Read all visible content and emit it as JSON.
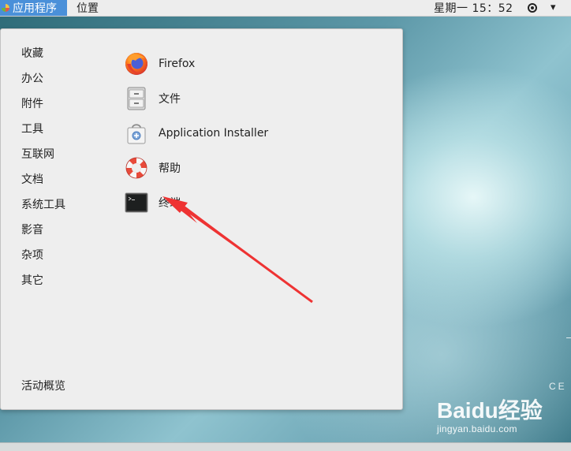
{
  "topbar": {
    "apps_label": "应用程序",
    "places_label": "位置",
    "clock": "星期一 15：52"
  },
  "menu": {
    "categories": [
      "收藏",
      "办公",
      "附件",
      "工具",
      "互联网",
      "文档",
      "系统工具",
      "影音",
      "杂项",
      "其它"
    ],
    "overview_label": "活动概览",
    "apps": [
      {
        "label": "Firefox",
        "icon": "firefox-icon"
      },
      {
        "label": "文件",
        "icon": "file-cabinet-icon"
      },
      {
        "label": "Application Installer",
        "icon": "software-bag-icon"
      },
      {
        "label": "帮助",
        "icon": "lifebuoy-icon"
      },
      {
        "label": "终端",
        "icon": "terminal-icon"
      }
    ]
  },
  "desktop": {
    "brand_text": "CE"
  },
  "watermark": {
    "logo": "Baidu经验",
    "url": "jingyan.baidu.com"
  },
  "colors": {
    "accent": "#4a90d9",
    "arrow": "#ee3333"
  }
}
